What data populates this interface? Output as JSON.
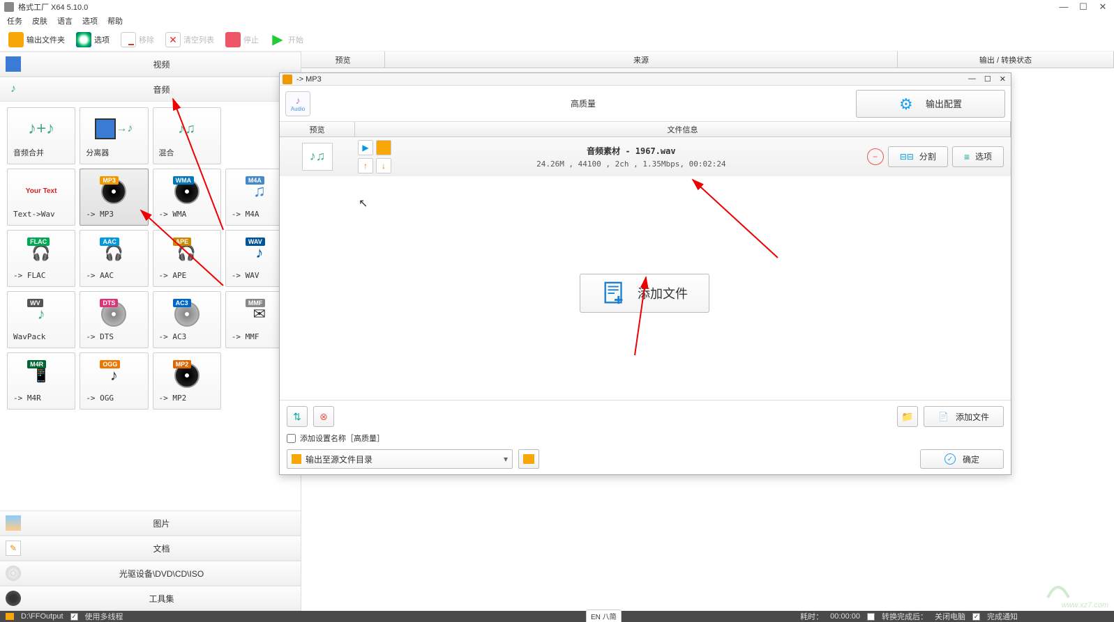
{
  "window": {
    "title": "格式工厂 X64 5.10.0"
  },
  "menu": {
    "task": "任务",
    "skin": "皮肤",
    "lang": "语言",
    "opt": "选项",
    "help": "帮助"
  },
  "toolbar": {
    "outfolder": "输出文件夹",
    "options": "选项",
    "remove": "移除",
    "clear": "清空列表",
    "stop": "停止",
    "start": "开始"
  },
  "categories": {
    "video": "视频",
    "audio": "音频",
    "image": "图片",
    "doc": "文档",
    "disc": "光驱设备\\DVD\\CD\\ISO",
    "tools": "工具集"
  },
  "formats": {
    "merge": "音频合并",
    "splitter": "分离器",
    "mix": "混合",
    "txtwav": "Text->Wav",
    "mp3": "-> MP3",
    "wma": "-> WMA",
    "m4a": "-> M4A",
    "flac": "-> FLAC",
    "aac": "-> AAC",
    "ape": "-> APE",
    "wav": "-> WAV",
    "wavpack": "WavPack",
    "dts": "-> DTS",
    "ac3": "-> AC3",
    "mmf": "-> MMF",
    "m4r": "-> M4R",
    "ogg": "-> OGG",
    "mp2": "-> MP2"
  },
  "badges": {
    "mp3": "MP3",
    "wma": "WMA",
    "m4a": "M4A",
    "flac": "FLAC",
    "aac": "AAC",
    "ape": "APE",
    "wav": "WAV",
    "wv": "WV",
    "dts": "DTS",
    "ac3": "AC3",
    "mmf": "MMF",
    "m4r": "M4R",
    "ogg": "OGG",
    "mp2": "MP2"
  },
  "listcols": {
    "preview": "预览",
    "source": "来源",
    "output": "输出 / 转换状态"
  },
  "dialog": {
    "title": "-> MP3",
    "audio_label": "Audio",
    "quality": "高质量",
    "output_config": "输出配置",
    "filecols": {
      "preview": "预览",
      "info": "文件信息"
    },
    "file": {
      "name": "音频素材 - 1967.wav",
      "detail": "24.26M , 44100 , 2ch , 1.35Mbps, 00:02:24"
    },
    "actions": {
      "split": "分割",
      "options": "选项"
    },
    "add_file": "添加文件",
    "add_setting": "添加设置名称［高质量］",
    "output_dir": "输出至源文件目录",
    "add_file_btn": "添加文件",
    "ok": "确定"
  },
  "statusbar": {
    "path": "D:\\FFOutput",
    "multithread": "使用多线程",
    "elapsed_label": "耗时：",
    "elapsed": "00:00:00",
    "after_label": "转换完成后：",
    "after": "关闭电脑",
    "notify": "完成通知",
    "lang": "EN 八简"
  },
  "watermark": "www.xz7.com"
}
